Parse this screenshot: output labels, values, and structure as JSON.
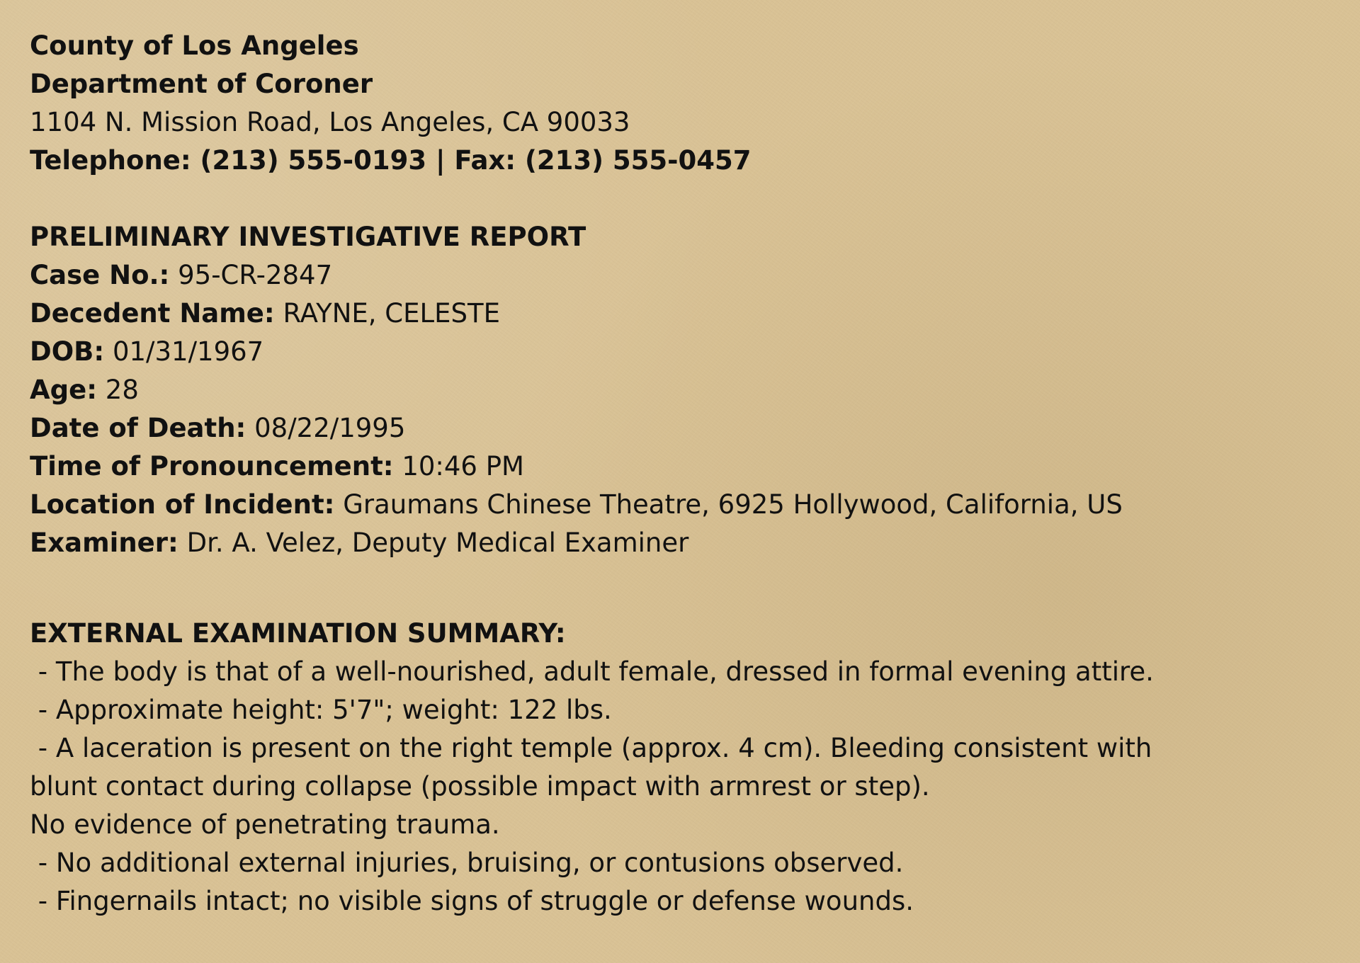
{
  "header": {
    "county": "County of Los Angeles",
    "department": "Department of Coroner",
    "address": "1104 N. Mission Road, Los Angeles, CA 90033",
    "contact": "Telephone: (213) 555-0193 | Fax: (213) 555-0457"
  },
  "report": {
    "title": "PRELIMINARY INVESTIGATIVE REPORT",
    "fields": [
      {
        "label": "Case No.:",
        "value": "95-CR-2847"
      },
      {
        "label": "Decedent Name:",
        "value": "RAYNE, CELESTE"
      },
      {
        "label": "DOB:",
        "value": "01/31/1967"
      },
      {
        "label": "Age:",
        "value": "28"
      },
      {
        "label": "Date of Death:",
        "value": "08/22/1995"
      },
      {
        "label": "Time of Pronouncement:",
        "value": "10:46 PM"
      },
      {
        "label": "Location of Incident:",
        "value": "Graumans Chinese Theatre, 6925 Hollywood, California, US"
      },
      {
        "label": "Examiner:",
        "value": "Dr. A. Velez, Deputy Medical Examiner"
      }
    ]
  },
  "summary": {
    "title": "EXTERNAL EXAMINATION SUMMARY:",
    "items": [
      " - The body is that of a well-nourished, adult female, dressed in formal evening attire.",
      " - Approximate height: 5'7\"; weight: 122 lbs.",
      " - A laceration is present on the right temple (approx. 4 cm). Bleeding consistent with blunt contact during collapse (possible impact with armrest or step).",
      "No evidence of penetrating trauma.",
      " - No additional external injuries, bruising, or contusions observed.",
      " - Fingernails intact; no visible signs of struggle or defense wounds."
    ]
  }
}
